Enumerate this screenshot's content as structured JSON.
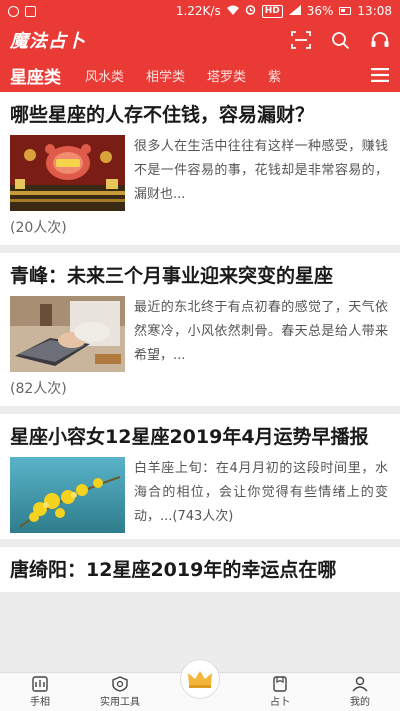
{
  "status": {
    "speed": "1.22K/s",
    "network_badge": "HD",
    "battery": "36%",
    "time": "13:08"
  },
  "app": {
    "title": "魔法占卜",
    "actions": [
      "scan-icon",
      "search-icon",
      "headset-icon"
    ]
  },
  "tabs": {
    "items": [
      "星座类",
      "风水类",
      "相学类",
      "塔罗类",
      "紫"
    ],
    "active_index": 0,
    "more_icon": "menu-icon"
  },
  "articles": [
    {
      "title": "哪些星座的人存不住钱，容易漏财？",
      "summary": "很多人在生活中往往有这样一种感受，赚钱不是一件容易的事，花钱却是非常容易的，漏财也...",
      "views": "(20人次)",
      "thumb": "golden-pig-image"
    },
    {
      "title": "青峰：未来三个月事业迎来突变的星座",
      "summary": "最近的东北终于有点初春的感觉了，天气依然寒冷，小风依然刺骨。春天总是给人带来希望，...",
      "views": "(82人次)",
      "thumb": "laptop-work-image"
    },
    {
      "title": "星座小容女12星座2019年4月运势早播报",
      "summary": "白羊座上旬：在4月月初的这段时间里，水海合的相位，会让你觉得有些情绪上的变动，...(743人次)",
      "views": "",
      "thumb": "yellow-flowers-image"
    },
    {
      "title": "唐绮阳：12星座2019年的幸运点在哪",
      "summary": "",
      "views": "",
      "thumb": ""
    }
  ],
  "bottom_nav": [
    {
      "label": "手相",
      "icon": "palm-icon"
    },
    {
      "label": "实用工具",
      "icon": "tools-icon"
    },
    {
      "label": "",
      "icon": "crown-icon"
    },
    {
      "label": "占卜",
      "icon": "divination-icon"
    },
    {
      "label": "我的",
      "icon": "profile-icon"
    }
  ],
  "colors": {
    "brand": "#ea3a35",
    "crown": "#f4b63a"
  }
}
